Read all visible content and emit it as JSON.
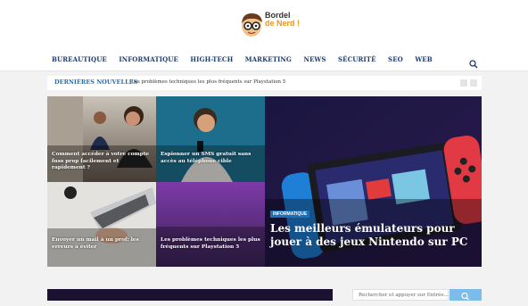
{
  "logo": {
    "line1": "Bordel",
    "line2": "de Nerd !"
  },
  "nav": {
    "items": [
      "BUREAUTIQUE",
      "INFORMATIQUE",
      "HIGH-TECH",
      "MARKETING",
      "NEWS",
      "SÉCURITÉ",
      "SEO",
      "WEB"
    ]
  },
  "ticker": {
    "label": "DERNIÈRES NOUVELLES",
    "text": "Les problèmes techniques les plus fréquents sur Playstation 5"
  },
  "tiles": {
    "t1": "Comment accéder à votre compte fnss prop facilement et rapidement ?",
    "t2": "Espionner un SMS gratuit sans accès au téléphone cible",
    "t3": "Envoyer un mail à un prof: les erreurs à éviter",
    "t4": "Les problèmes techniques les plus fréquents sur Playstation 5",
    "big_badge": "INFORMATIQUE",
    "big_title": "Les meilleurs émulateurs pour jouer à des jeux Nintendo sur PC"
  },
  "sidebar": {
    "search_placeholder": "Rechercher et appuyer sur Entrée..."
  },
  "colors": {
    "nav": "#1d3c6e",
    "accent": "#1d6fb8",
    "button": "#7bbcea"
  }
}
